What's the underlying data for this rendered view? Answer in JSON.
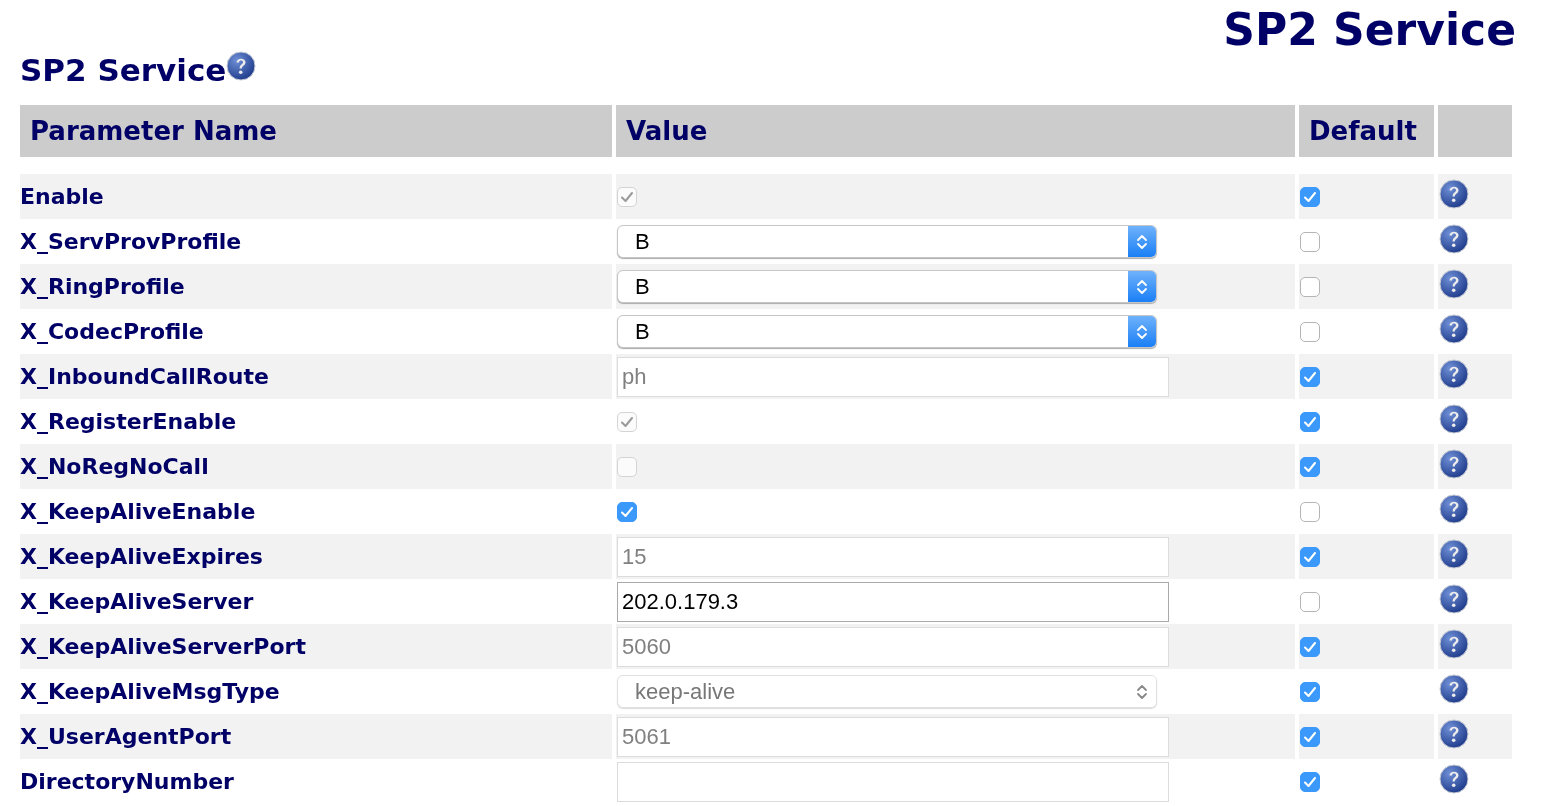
{
  "page_title": "SP2 Service",
  "section": {
    "title": "SP2 Service"
  },
  "table": {
    "columns": [
      "Parameter Name",
      "Value",
      "Default"
    ],
    "rows": [
      {
        "name": "Enable",
        "kind": "checkbox",
        "disabled": true,
        "checked": true,
        "default": true
      },
      {
        "name": "X_ServProvProfile",
        "kind": "select",
        "disabled": false,
        "value": "B",
        "default": false
      },
      {
        "name": "X_RingProfile",
        "kind": "select",
        "disabled": false,
        "value": "B",
        "default": false
      },
      {
        "name": "X_CodecProfile",
        "kind": "select",
        "disabled": false,
        "value": "B",
        "default": false
      },
      {
        "name": "X_InboundCallRoute",
        "kind": "text",
        "disabled": true,
        "value": "ph",
        "default": true
      },
      {
        "name": "X_RegisterEnable",
        "kind": "checkbox",
        "disabled": true,
        "checked": true,
        "default": true
      },
      {
        "name": "X_NoRegNoCall",
        "kind": "checkbox",
        "disabled": true,
        "checked": false,
        "default": true
      },
      {
        "name": "X_KeepAliveEnable",
        "kind": "checkbox",
        "disabled": false,
        "checked": true,
        "default": false
      },
      {
        "name": "X_KeepAliveExpires",
        "kind": "text",
        "disabled": true,
        "value": "15",
        "default": true
      },
      {
        "name": "X_KeepAliveServer",
        "kind": "text",
        "disabled": false,
        "value": "202.0.179.3",
        "default": false
      },
      {
        "name": "X_KeepAliveServerPort",
        "kind": "text",
        "disabled": true,
        "value": "5060",
        "default": true
      },
      {
        "name": "X_KeepAliveMsgType",
        "kind": "select",
        "disabled": true,
        "value": "keep-alive",
        "default": true
      },
      {
        "name": "X_UserAgentPort",
        "kind": "text",
        "disabled": true,
        "value": "5061",
        "default": true
      },
      {
        "name": "DirectoryNumber",
        "kind": "text",
        "disabled": true,
        "default": true
      }
    ]
  }
}
